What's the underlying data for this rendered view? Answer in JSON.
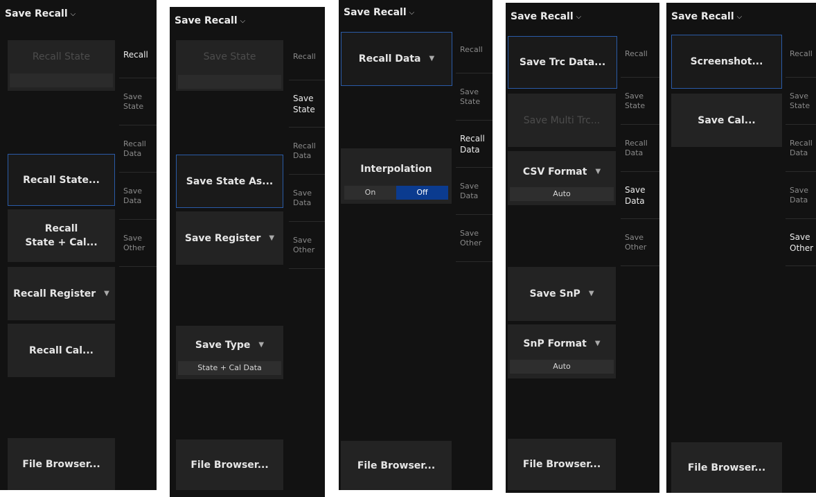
{
  "header": {
    "title": "Save Recall",
    "chevron": "⌵"
  },
  "tabs": [
    "Recall",
    "Save\nState",
    "Recall\nData",
    "Save\nData",
    "Save\nOther"
  ],
  "panel1": {
    "recall_state_label": "Recall State",
    "recall_state_dialog": "Recall State...",
    "recall_state_cal": "Recall\nState + Cal...",
    "recall_register": "Recall Register",
    "recall_cal": "Recall Cal...",
    "file_browser": "File Browser..."
  },
  "panel2": {
    "save_state_label": "Save State",
    "save_state_as": "Save State As...",
    "save_register": "Save Register",
    "save_type": "Save Type",
    "save_type_value": "State + Cal Data",
    "file_browser": "File Browser..."
  },
  "panel3": {
    "recall_data": "Recall Data",
    "interpolation": "Interpolation",
    "toggle_on": "On",
    "toggle_off": "Off",
    "interpolation_selected": "Off",
    "file_browser": "File Browser..."
  },
  "panel4": {
    "save_trc_data": "Save Trc Data...",
    "save_multi_trc": "Save Multi Trc...",
    "csv_format": "CSV Format",
    "csv_format_value": "Auto",
    "save_snp": "Save SnP",
    "snp_format": "SnP Format",
    "snp_format_value": "Auto",
    "file_browser": "File Browser..."
  },
  "panel5": {
    "screenshot": "Screenshot...",
    "save_cal": "Save Cal...",
    "file_browser": "File Browser..."
  },
  "icons": {
    "dropdown": "▼"
  },
  "colors": {
    "selected_border": "#2a5ba8",
    "toggle_active": "#0b3b8f"
  }
}
